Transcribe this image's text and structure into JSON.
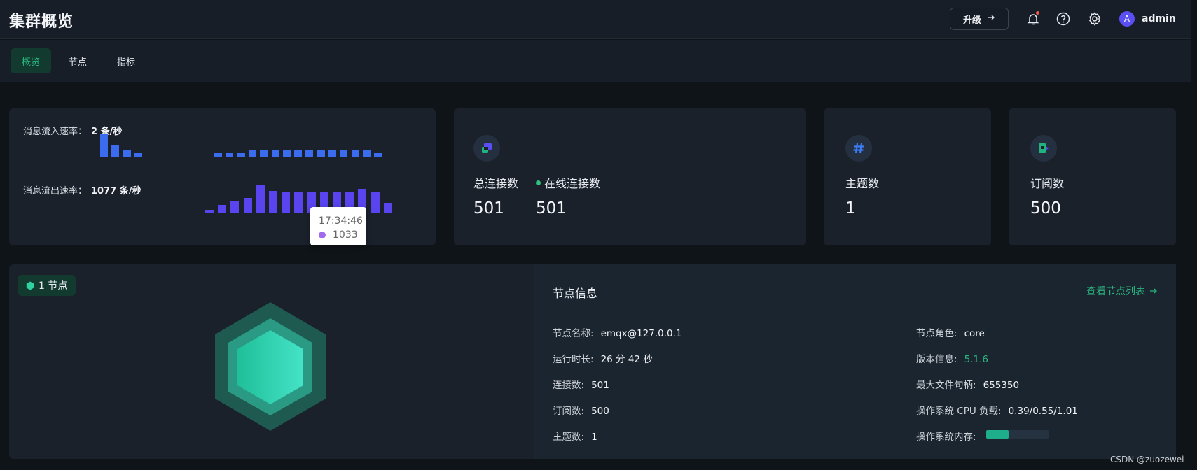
{
  "header": {
    "title": "集群概览",
    "upgrade_label": "升级",
    "user": {
      "initial": "A",
      "name": "admin"
    }
  },
  "tabs": [
    {
      "label": "概览",
      "active": true
    },
    {
      "label": "节点",
      "active": false
    },
    {
      "label": "指标",
      "active": false
    }
  ],
  "rates": {
    "in_label": "消息流入速率：",
    "in_value": "2 条/秒",
    "out_label": "消息流出速率：",
    "out_value": "1077 条/秒",
    "in_color": "#3b6cf0",
    "out_color": "#5a44f0",
    "tooltip": {
      "time": "17:34:46",
      "value": "1033"
    }
  },
  "chart_data": [
    {
      "type": "bar",
      "name": "消息流入速率",
      "values": [
        4,
        2,
        1.2,
        0.7,
        null,
        null,
        null,
        null,
        null,
        null,
        0.7,
        0.7,
        0.7,
        1.3,
        1.3,
        1.3,
        1.3,
        1.3,
        1.3,
        1.3,
        1.3,
        1.3,
        1.3,
        1.3,
        0.7
      ]
    },
    {
      "type": "bar",
      "name": "消息流出速率",
      "values": [
        150,
        400,
        550,
        750,
        1400,
        1100,
        1033,
        1033,
        1033,
        1033,
        1000,
        1000,
        1200,
        1000,
        500
      ]
    }
  ],
  "stats": {
    "connections": {
      "label": "总连接数",
      "value": "501"
    },
    "online": {
      "label": "在线连接数",
      "value": "501"
    },
    "topics": {
      "label": "主题数",
      "value": "1"
    },
    "subscriptions": {
      "label": "订阅数",
      "value": "500"
    }
  },
  "nodes": {
    "badge": "1 节点",
    "info_title": "节点信息",
    "view_link": "查看节点列表",
    "left": [
      {
        "label": "节点名称:",
        "value": "emqx@127.0.0.1"
      },
      {
        "label": "运行时长:",
        "value": "26 分 42 秒"
      },
      {
        "label": "连接数:",
        "value": "501"
      },
      {
        "label": "订阅数:",
        "value": "500"
      },
      {
        "label": "主题数:",
        "value": "1"
      }
    ],
    "right": [
      {
        "label": "节点角色:",
        "value": "core"
      },
      {
        "label": "版本信息:",
        "value": "5.1.6"
      },
      {
        "label": "最大文件句柄:",
        "value": "655350"
      },
      {
        "label": "操作系统 CPU 负载:",
        "value": "0.39/0.55/1.01"
      },
      {
        "label": "操作系统内存:",
        "value": ""
      }
    ],
    "memory_fraction": 0.35
  },
  "watermark": "CSDN @zuozewei"
}
